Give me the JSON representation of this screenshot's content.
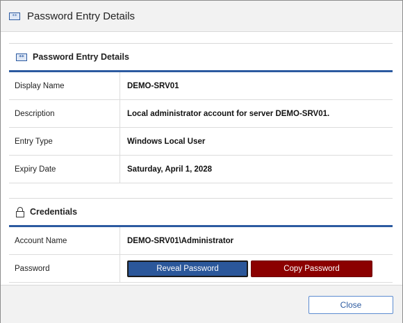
{
  "window": {
    "title": "Password Entry Details",
    "icon": "password-entry-icon",
    "icon_glyph": "**"
  },
  "details_section": {
    "heading": "Password Entry Details",
    "icon": "password-entry-icon",
    "rows": [
      {
        "label": "Display Name",
        "value": "DEMO-SRV01"
      },
      {
        "label": "Description",
        "value": "Local administrator account for server DEMO-SRV01."
      },
      {
        "label": "Entry Type",
        "value": "Windows Local User"
      },
      {
        "label": "Expiry Date",
        "value": "Saturday, April 1, 2028"
      }
    ]
  },
  "credentials_section": {
    "heading": "Credentials",
    "icon": "lock-icon",
    "account_label": "Account Name",
    "account_value": "DEMO-SRV01\\Administrator",
    "password_label": "Password",
    "reveal_label": "Reveal Password",
    "copy_label": "Copy Password"
  },
  "footer": {
    "close_label": "Close"
  },
  "colors": {
    "accent": "#2c5aa0",
    "reveal_button": "#2b579a",
    "copy_button": "#8b0000"
  }
}
